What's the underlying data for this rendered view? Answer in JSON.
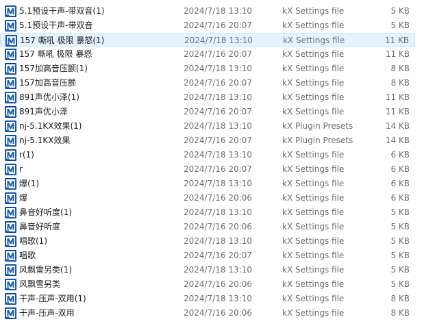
{
  "colors": {
    "selection_bg": "#e5f3ff",
    "icon_blue": "#1f5fb0",
    "secondary_text": "#6d6d6d"
  },
  "icon": "kx-file-icon",
  "files": [
    {
      "name": "5.1预设干声-带双音(1)",
      "date": "2024/7/18 13:10",
      "type": "kX Settings file",
      "size": "5 KB"
    },
    {
      "name": "5.1预设干声-带双音",
      "date": "2024/7/16 20:07",
      "type": "kX Settings file",
      "size": "5 KB"
    },
    {
      "name": "157 嘶吼 极限 暴怒(1)",
      "date": "2024/7/18 13:10",
      "type": "kX Settings file",
      "size": "11 KB",
      "selected": true
    },
    {
      "name": "157 嘶吼 极限 暴怒",
      "date": "2024/7/16 20:07",
      "type": "kX Settings file",
      "size": "11 KB"
    },
    {
      "name": "157加高音压颤(1)",
      "date": "2024/7/18 13:10",
      "type": "kX Settings file",
      "size": "8 KB"
    },
    {
      "name": "157加高音压颤",
      "date": "2024/7/16 20:07",
      "type": "kX Settings file",
      "size": "8 KB"
    },
    {
      "name": "891声优小泽(1)",
      "date": "2024/7/18 13:10",
      "type": "kX Settings file",
      "size": "11 KB"
    },
    {
      "name": "891声优小泽",
      "date": "2024/7/16 20:07",
      "type": "kX Settings file",
      "size": "11 KB"
    },
    {
      "name": "nj-5.1KX效果(1)",
      "date": "2024/7/18 13:10",
      "type": "kX Plugin Presets",
      "size": "14 KB"
    },
    {
      "name": "nj-5.1KX效果",
      "date": "2024/7/16 20:07",
      "type": "kX Plugin Presets",
      "size": "14 KB"
    },
    {
      "name": "r(1)",
      "date": "2024/7/18 13:10",
      "type": "kX Settings file",
      "size": "6 KB"
    },
    {
      "name": "r",
      "date": "2024/7/16 20:07",
      "type": "kX Settings file",
      "size": "6 KB"
    },
    {
      "name": "爆(1)",
      "date": "2024/7/18 13:10",
      "type": "kX Settings file",
      "size": "6 KB"
    },
    {
      "name": "爆",
      "date": "2024/7/16 20:06",
      "type": "kX Settings file",
      "size": "6 KB"
    },
    {
      "name": "鼻音好听度(1)",
      "date": "2024/7/18 13:10",
      "type": "kX Settings file",
      "size": "5 KB"
    },
    {
      "name": "鼻音好听度",
      "date": "2024/7/16 20:06",
      "type": "kX Settings file",
      "size": "5 KB"
    },
    {
      "name": "唱歌(1)",
      "date": "2024/7/18 13:10",
      "type": "kX Settings file",
      "size": "5 KB"
    },
    {
      "name": "唱歌",
      "date": "2024/7/16 20:07",
      "type": "kX Settings file",
      "size": "5 KB"
    },
    {
      "name": "风飘雪另类(1)",
      "date": "2024/7/18 13:10",
      "type": "kX Settings file",
      "size": "5 KB"
    },
    {
      "name": "风飘雪另类",
      "date": "2024/7/16 20:06",
      "type": "kX Settings file",
      "size": "5 KB"
    },
    {
      "name": "干声-压声-双用(1)",
      "date": "2024/7/18 13:10",
      "type": "kX Settings file",
      "size": "8 KB"
    },
    {
      "name": "干声-压声-双用",
      "date": "2024/7/16 20:06",
      "type": "kX Settings file",
      "size": "8 KB"
    }
  ]
}
